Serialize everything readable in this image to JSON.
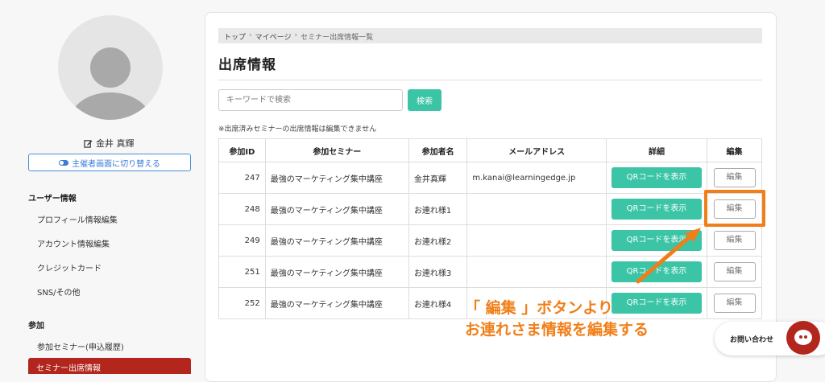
{
  "sidebar": {
    "username": "金井 真輝",
    "switch_label": "主催者画面に切り替える",
    "user_section": "ユーザー情報",
    "user_items": [
      "プロフィール情報編集",
      "アカウント情報編集",
      "クレジットカード",
      "SNS/その他"
    ],
    "join_section": "参加",
    "join_items": [
      "参加セミナー(申込履歴)"
    ],
    "active_item": "セミナー出席情報"
  },
  "breadcrumb": [
    "トップ",
    "マイページ",
    "セミナー出席情報一覧"
  ],
  "page_title": "出席情報",
  "search": {
    "placeholder": "キーワードで検索",
    "button": "検索"
  },
  "note": "※出席済みセミナーの出席情報は編集できません",
  "table": {
    "headers": [
      "参加ID",
      "参加セミナー",
      "参加者名",
      "メールアドレス",
      "詳細",
      "編集"
    ],
    "rows": [
      {
        "id": "247",
        "seminar": "最強のマーケティング集中講座",
        "name": "金井真輝",
        "email": "m.kanai@learningedge.jp",
        "detail": "QRコードを表示",
        "edit": "編集"
      },
      {
        "id": "248",
        "seminar": "最強のマーケティング集中講座",
        "name": "お連れ様1",
        "email": "",
        "detail": "QRコードを表示",
        "edit": "編集"
      },
      {
        "id": "249",
        "seminar": "最強のマーケティング集中講座",
        "name": "お連れ様2",
        "email": "",
        "detail": "QRコードを表示",
        "edit": "編集"
      },
      {
        "id": "251",
        "seminar": "最強のマーケティング集中講座",
        "name": "お連れ様3",
        "email": "",
        "detail": "QRコードを表示",
        "edit": "編集"
      },
      {
        "id": "252",
        "seminar": "最強のマーケティング集中講座",
        "name": "お連れ様4",
        "email": "",
        "detail": "QRコードを表示",
        "edit": "編集"
      }
    ]
  },
  "annotation": {
    "line1": "「 編集 」ボタンより",
    "line2": "お連れさま情報を編集する",
    "color": "#f07f1a"
  },
  "contact": {
    "label": "お問い合わせ"
  },
  "colors": {
    "accent": "#3cc4a6",
    "brand": "#b3261e",
    "link": "#3a7bd5"
  },
  "icons": {
    "edit": "pencil-icon",
    "switch": "toggle-icon",
    "chat": "chat-icon"
  }
}
